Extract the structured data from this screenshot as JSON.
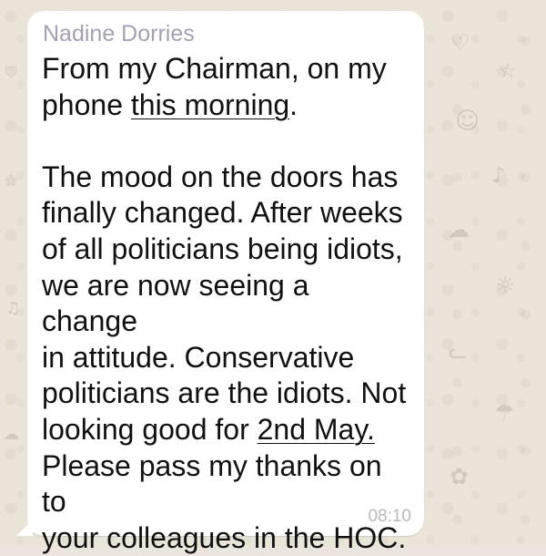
{
  "chat": {
    "sender": "Nadine Dorries",
    "message": {
      "line1a": "From my Chairman, on my",
      "line2a": "phone ",
      "line2_link": "this morning",
      "line2b": ".",
      "paragraph2": "The mood on the doors has\nfinally changed. After weeks\nof all politicians being idiots,\nwe are now seeing a change\nin attitude. Conservative\npoliticians are the idiots. Not\nlooking good for ",
      "date_link": "2nd May.",
      "paragraph2_end": "\nPlease pass my thanks on to\nyour colleagues in the HOC."
    },
    "timestamp": "08:10"
  },
  "colors": {
    "bubble": "#ffffff",
    "sender_name": "#a79fb3",
    "wallpaper": "#ebe4d9",
    "timestamp": "#b9b9b9"
  },
  "icons": [
    "wallpaper-doodle-icons"
  ]
}
